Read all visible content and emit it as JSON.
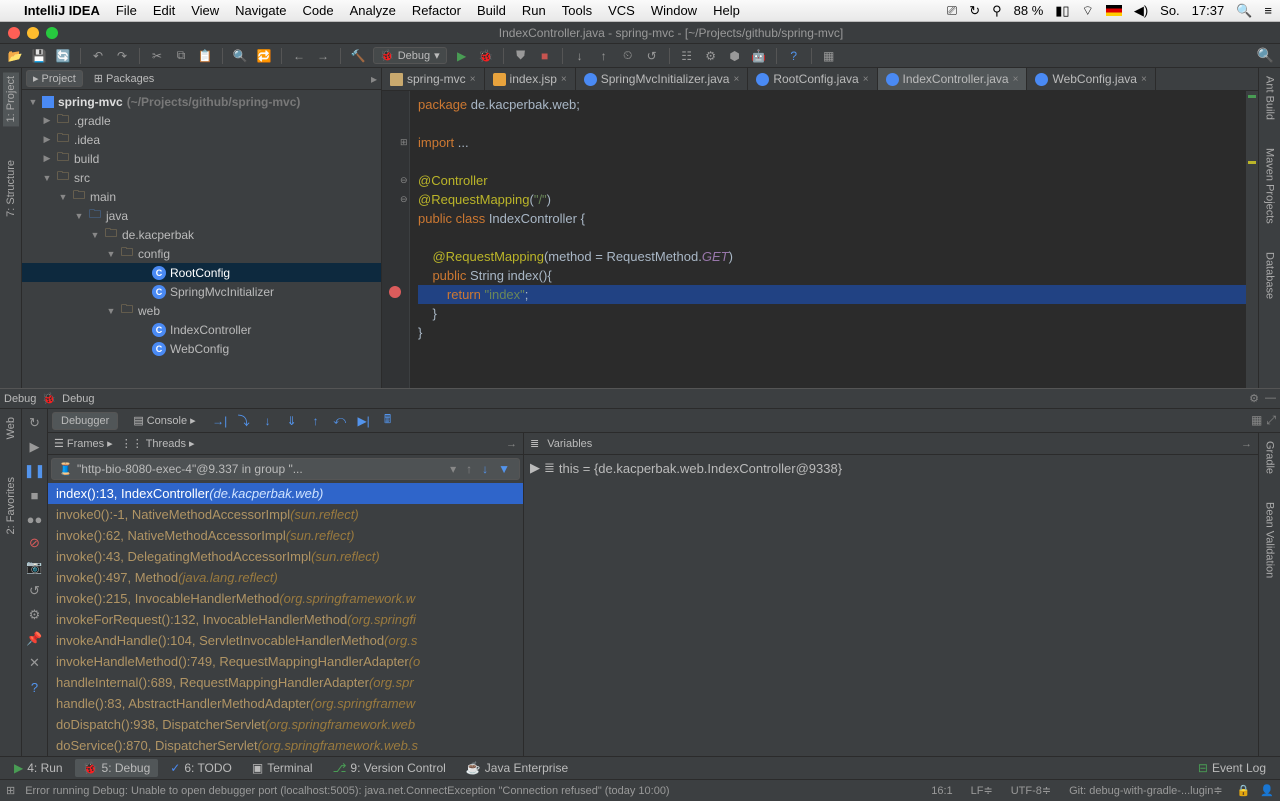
{
  "mac": {
    "app": "IntelliJ IDEA",
    "menus": [
      "File",
      "Edit",
      "View",
      "Navigate",
      "Code",
      "Analyze",
      "Refactor",
      "Build",
      "Run",
      "Tools",
      "VCS",
      "Window",
      "Help"
    ],
    "battery": "88 %",
    "day": "So.",
    "time": "17:37"
  },
  "window": {
    "title": "IndexController.java - spring-mvc - [~/Projects/github/spring-mvc]"
  },
  "runconfig": {
    "label": "Debug"
  },
  "leftTabs": {
    "project": "1: Project",
    "structure": "7: Structure"
  },
  "leftTabs2": {
    "web": "Web",
    "favorites": "2: Favorites"
  },
  "rightTabs": {
    "ant": "Ant Build",
    "maven": "Maven Projects",
    "db": "Database",
    "gradle": "Gradle",
    "bean": "Bean Validation"
  },
  "projectHeader": {
    "project": "Project",
    "packages": "Packages"
  },
  "tree": {
    "root_name": "spring-mvc",
    "root_path": "(~/Projects/github/spring-mvc)",
    "gradle": ".gradle",
    "idea": ".idea",
    "build": "build",
    "src": "src",
    "main": "main",
    "java": "java",
    "pkg": "de.kacperbak",
    "config": "config",
    "rootConfig": "RootConfig",
    "springInit": "SpringMvcInitializer",
    "web": "web",
    "indexCtrl": "IndexController",
    "webConfig": "WebConfig"
  },
  "editorTabs": [
    {
      "label": "spring-mvc",
      "kind": "folder"
    },
    {
      "label": "index.jsp",
      "kind": "jsp"
    },
    {
      "label": "SpringMvcInitializer.java",
      "kind": "class"
    },
    {
      "label": "RootConfig.java",
      "kind": "class"
    },
    {
      "label": "IndexController.java",
      "kind": "class",
      "active": true
    },
    {
      "label": "WebConfig.java",
      "kind": "class"
    }
  ],
  "code": {
    "l1a": "package ",
    "l1b": "de.kacperbak.web;",
    "l2a": "import ",
    "l2b": "...",
    "l3": "@Controller",
    "l4a": "@RequestMapping",
    "l4b": "(",
    "l4c": "\"/\"",
    "l4d": ")",
    "l5a": "public class ",
    "l5b": "IndexController {",
    "l6a": "    @RequestMapping",
    "l6b": "(method = RequestMethod.",
    "l6c": "GET",
    "l6d": ")",
    "l7a": "    public ",
    "l7b": "String index(){",
    "l8a": "        return ",
    "l8b": "\"index\"",
    "l8c": ";",
    "l9": "    }",
    "l10": "}"
  },
  "debug": {
    "title": "Debug",
    "debugger": "Debugger",
    "console": "Console",
    "frames": "Frames",
    "threads": "Threads",
    "variables": "Variables",
    "thread": "\"http-bio-8080-exec-4\"@9.337 in group \"...",
    "var": "this = {de.kacperbak.web.IndexController@9338}"
  },
  "frames": [
    {
      "m": "index():13, IndexController ",
      "p": "(de.kacperbak.web)",
      "active": true
    },
    {
      "m": "invoke0():-1, NativeMethodAccessorImpl ",
      "p": "(sun.reflect)"
    },
    {
      "m": "invoke():62, NativeMethodAccessorImpl ",
      "p": "(sun.reflect)"
    },
    {
      "m": "invoke():43, DelegatingMethodAccessorImpl ",
      "p": "(sun.reflect)"
    },
    {
      "m": "invoke():497, Method ",
      "p": "(java.lang.reflect)"
    },
    {
      "m": "invoke():215, InvocableHandlerMethod ",
      "p": "(org.springframework.w"
    },
    {
      "m": "invokeForRequest():132, InvocableHandlerMethod ",
      "p": "(org.springfi"
    },
    {
      "m": "invokeAndHandle():104, ServletInvocableHandlerMethod ",
      "p": "(org.s"
    },
    {
      "m": "invokeHandleMethod():749, RequestMappingHandlerAdapter ",
      "p": "(o"
    },
    {
      "m": "handleInternal():689, RequestMappingHandlerAdapter ",
      "p": "(org.spr"
    },
    {
      "m": "handle():83, AbstractHandlerMethodAdapter ",
      "p": "(org.springframew"
    },
    {
      "m": "doDispatch():938, DispatcherServlet ",
      "p": "(org.springframework.web"
    },
    {
      "m": "doService():870, DispatcherServlet ",
      "p": "(org.springframework.web.s"
    }
  ],
  "bottom": {
    "run": "4: Run",
    "debug": "5: Debug",
    "todo": "6: TODO",
    "terminal": "Terminal",
    "vcs": "9: Version Control",
    "jee": "Java Enterprise",
    "eventlog": "Event Log"
  },
  "status": {
    "msg": "Error running Debug: Unable to open debugger port (localhost:5005): java.net.ConnectException \"Connection refused\" (today 10:00)",
    "pos": "16:1",
    "lf": "LF≑",
    "enc": "UTF-8≑",
    "git": "Git: debug-with-gradle-...lugin≑"
  }
}
